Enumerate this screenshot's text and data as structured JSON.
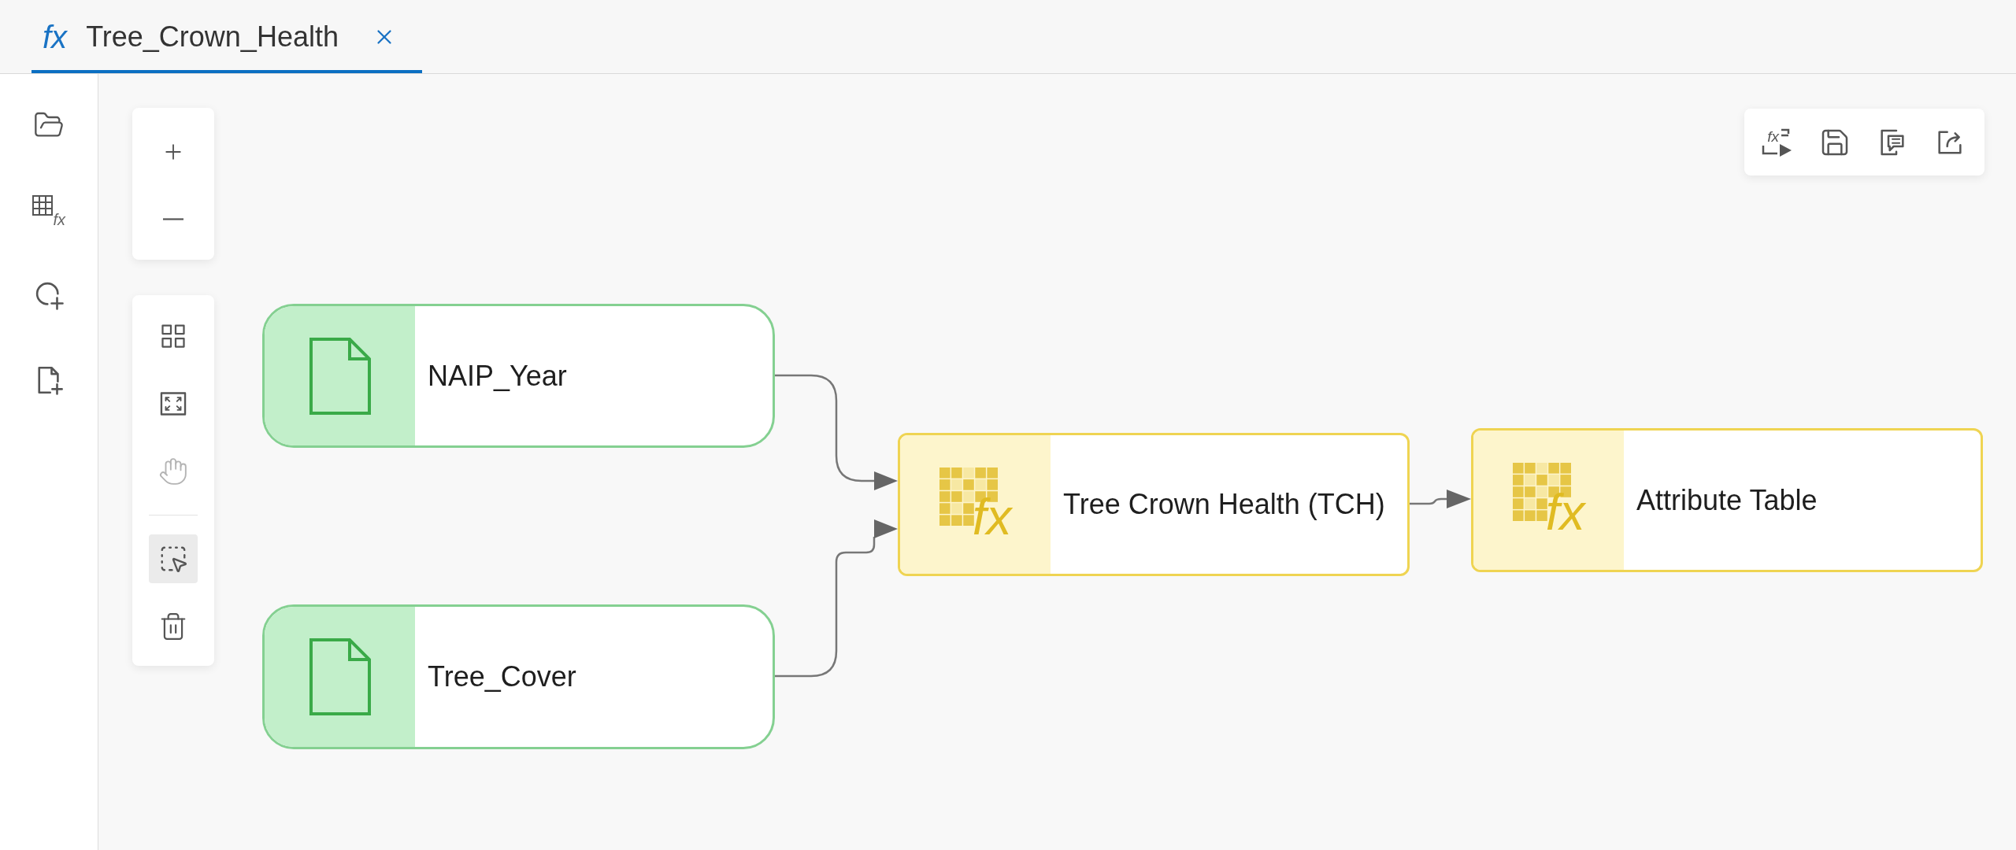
{
  "tab_bar": {
    "tabs": [
      {
        "icon_glyph": "fx",
        "label": "Tree_Crown_Health",
        "selected": true
      }
    ]
  },
  "sidebar": {
    "items": [
      {
        "kind": "open"
      },
      {
        "kind": "add-function",
        "glyph": "fx"
      },
      {
        "kind": "add-shape"
      },
      {
        "kind": "add-file"
      }
    ]
  },
  "zoom_controls": [
    {
      "kind": "zoom-in"
    },
    {
      "kind": "zoom-out"
    }
  ],
  "canvas_tools": [
    {
      "tools": [
        {
          "kind": "layout",
          "selected": false,
          "disabled": false
        },
        {
          "kind": "fit",
          "selected": false,
          "disabled": false
        },
        {
          "kind": "pan",
          "selected": false,
          "disabled": true
        }
      ]
    },
    {
      "tools": [
        {
          "kind": "select",
          "selected": true,
          "disabled": false
        },
        {
          "kind": "delete",
          "selected": false,
          "disabled": false
        }
      ]
    }
  ],
  "toolbar": [
    {
      "kind": "run",
      "glyph": "fx"
    },
    {
      "kind": "save"
    },
    {
      "kind": "notes"
    },
    {
      "kind": "export"
    }
  ],
  "graph": {
    "nodes": [
      {
        "kind": "input",
        "label": "NAIP_Year"
      },
      {
        "kind": "input",
        "label": "Tree_Cover"
      },
      {
        "kind": "function",
        "glyph": "fx",
        "label": "Tree Crown Health (TCH)"
      },
      {
        "kind": "function",
        "glyph": "fx",
        "label": "Attribute Table"
      }
    ]
  }
}
